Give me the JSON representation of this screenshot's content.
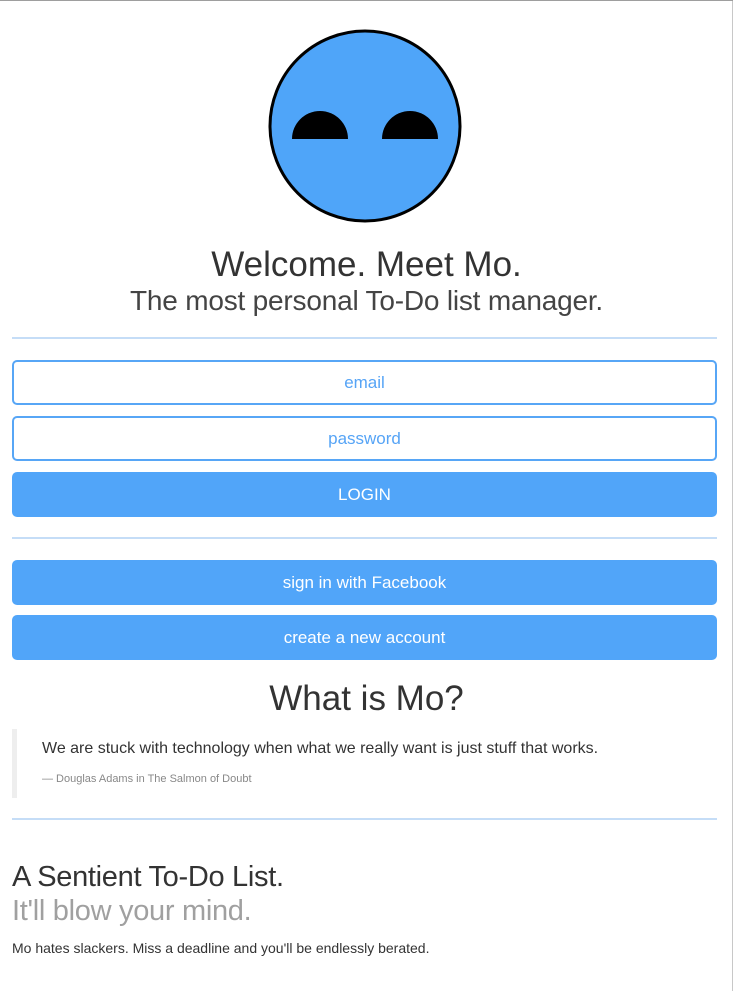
{
  "hero": {
    "mascot_icon": "mo-face-icon",
    "mascot_color": "#51a5f9",
    "title": "Welcome. Meet Mo.",
    "tagline": "The most personal To-Do list manager."
  },
  "login_form": {
    "email_placeholder": "email",
    "password_placeholder": "password",
    "login_label": "LOGIN"
  },
  "alt_actions": {
    "facebook_label": "sign in with Facebook",
    "create_account_label": "create a new account"
  },
  "about": {
    "heading": "What is Mo?",
    "quote_text": "We are stuck with technology when what we really want is just stuff that works.",
    "quote_cite": "— Douglas Adams in The Salmon of Doubt"
  },
  "feature": {
    "title": "A Sentient To-Do List.",
    "subtitle": "It'll blow your mind.",
    "body": "Mo hates slackers. Miss a deadline and you'll be endlessly berated."
  },
  "colors": {
    "accent": "#51a5f9",
    "divider": "#c5ddf7",
    "input_border": "#57a6f6"
  }
}
